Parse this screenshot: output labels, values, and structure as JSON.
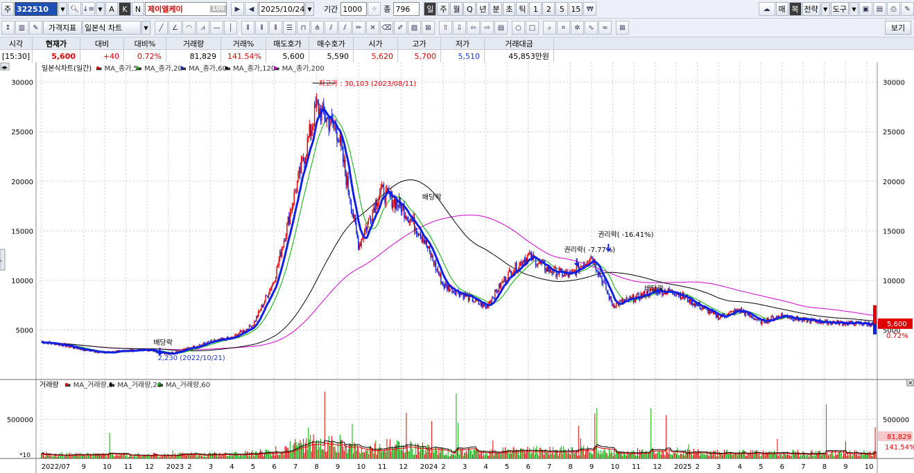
{
  "toolbar": {
    "market_label": "주",
    "stock_code": "322510",
    "stock_name": "제이엘케이",
    "name_badge": "100",
    "date": "2025/10/24",
    "period_label": "기간",
    "period_value": "1000",
    "count_label": "종",
    "count_value": "796",
    "intervals": [
      "일",
      "주",
      "월",
      "Q",
      "년",
      "분",
      "초",
      "틱",
      "1",
      "2",
      "5",
      "15"
    ],
    "active_interval": "일",
    "buttons_A": "A",
    "buttons_K": "K",
    "buttons_N": "N",
    "right_buttons": [
      "매",
      "복",
      "전략",
      "도구"
    ],
    "indicator_label": "가격지표",
    "chart_type": "일본식 차트",
    "view_label": "보기"
  },
  "quote": {
    "headers": [
      "시각",
      "현재가",
      "대비",
      "대비%",
      "거래량",
      "거래%",
      "매도호가",
      "매수호가",
      "시가",
      "고가",
      "저가",
      "거래대금"
    ],
    "values": [
      "[15:30]",
      "5,600",
      "+40",
      "0.72%",
      "81,829",
      "141.54%",
      "5,600",
      "5,590",
      "5,620",
      "5,700",
      "5,510",
      "45,853만원"
    ]
  },
  "chart_data": {
    "type": "line",
    "title": "일본식차트(일간)",
    "legend": [
      {
        "name": "MA_종가,5",
        "color": "#e00000"
      },
      {
        "name": "MA_종가,20",
        "color": "#00b000"
      },
      {
        "name": "MA_종가,60",
        "color": "#1020e0"
      },
      {
        "name": "MA_종가,120",
        "color": "#000000"
      },
      {
        "name": "MA_종가,200",
        "color": "#d000d0"
      }
    ],
    "y_ticks": [
      5000,
      10000,
      15000,
      20000,
      25000,
      30000
    ],
    "ylim": [
      0,
      32000
    ],
    "x_labels": [
      "2022/07",
      "9",
      "10",
      "11",
      "12",
      "2023",
      "2",
      "3",
      "4",
      "5",
      "6",
      "7",
      "8",
      "9",
      "10",
      "11",
      "12",
      "2024",
      "2",
      "3",
      "4",
      "5",
      "6",
      "7",
      "8",
      "9",
      "10",
      "11",
      "12",
      "2025",
      "2",
      "3",
      "4",
      "5",
      "6",
      "7",
      "8",
      "9",
      "10"
    ],
    "x_months": [
      0,
      2,
      3,
      4,
      5,
      6,
      7,
      8,
      9,
      10,
      11,
      12,
      13,
      14,
      15,
      16,
      17,
      18,
      19,
      20,
      21,
      22,
      23,
      24,
      25,
      26,
      27,
      28,
      29,
      30,
      31,
      32,
      33,
      34,
      35,
      36,
      37,
      38,
      39
    ],
    "close": {
      "months": [
        0,
        1,
        2,
        3,
        4,
        5,
        6,
        7,
        8,
        9,
        10,
        11,
        12,
        13,
        14,
        15,
        16,
        17,
        18,
        19,
        20,
        21,
        22,
        23,
        24,
        25,
        26,
        27,
        28,
        29,
        30,
        31,
        32,
        33,
        34,
        35,
        36,
        37,
        38,
        39.5
      ],
      "values": [
        3800,
        3500,
        3000,
        2700,
        2900,
        3000,
        2600,
        3200,
        3800,
        4200,
        5500,
        10000,
        19000,
        27500,
        25000,
        13500,
        19000,
        17500,
        14500,
        9500,
        8500,
        7300,
        10500,
        12500,
        11000,
        10500,
        12500,
        7500,
        8200,
        9000,
        8800,
        7500,
        6300,
        7000,
        5800,
        6500,
        6000,
        5800,
        5700,
        5600
      ]
    },
    "annotations": [
      {
        "text": "최고가 : 30,103 (2023/08/11)",
        "color": "#e00000"
      },
      {
        "text": "배당락",
        "color": "#000000"
      },
      {
        "text": "배당락",
        "color": "#000000"
      },
      {
        "text": "배당락",
        "color": "#000000"
      },
      {
        "text": "권리락( -7.77%)",
        "color": "#000000"
      },
      {
        "text": "권리락( -16.41%)",
        "color": "#000000"
      },
      {
        "text": "2,230 (2022/10/21)",
        "color": "#1a36d8"
      }
    ],
    "current_price_label": "5,600",
    "current_change_label": "0.72%",
    "volume_panel": {
      "title": "거래량",
      "legend": [
        {
          "name": "MA_거래량,5",
          "color": "#e00000"
        },
        {
          "name": "MA_거래량,20",
          "color": "#000000"
        },
        {
          "name": "MA_거래량,60",
          "color": "#00b000"
        }
      ],
      "y_ticks": [
        500000
      ],
      "ylim": [
        0,
        900000
      ],
      "unit_label": "*10",
      "current_volume_label": "81,829",
      "current_ratio_label": "141.54%"
    }
  }
}
